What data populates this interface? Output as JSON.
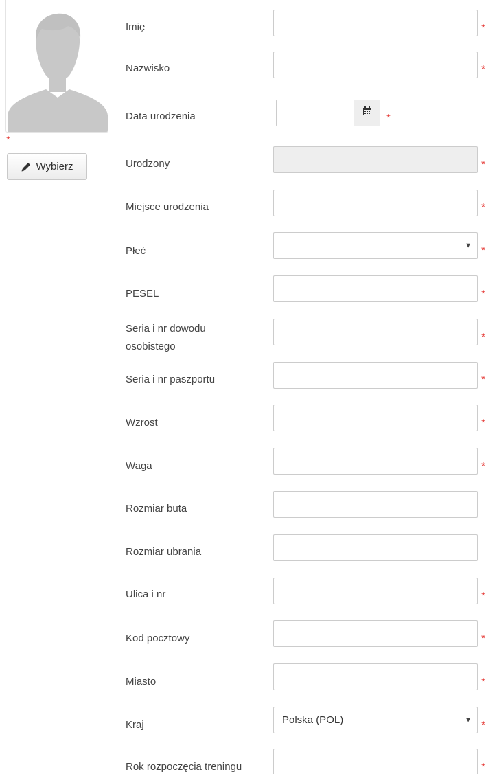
{
  "photo": {
    "required_mark": "*",
    "choose_label": "Wybierz",
    "avatar_icon": "avatar-placeholder-icon",
    "pencil_icon": "pencil-icon"
  },
  "required_mark": "*",
  "fields": {
    "first_name": {
      "label": "Imię",
      "value": ""
    },
    "last_name": {
      "label": "Nazwisko",
      "value": ""
    },
    "birth_date": {
      "label": "Data urodzenia",
      "value": "",
      "icon": "calendar-icon"
    },
    "born": {
      "label": "Urodzony",
      "value": ""
    },
    "birth_place": {
      "label": "Miejsce urodzenia",
      "value": ""
    },
    "gender": {
      "label": "Płeć",
      "selected": ""
    },
    "pesel": {
      "label": "PESEL",
      "value": ""
    },
    "id_card": {
      "label": "Seria i nr dowodu osobistego",
      "value": ""
    },
    "passport": {
      "label": "Seria i nr paszportu",
      "value": ""
    },
    "height": {
      "label": "Wzrost",
      "value": ""
    },
    "weight": {
      "label": "Waga",
      "value": ""
    },
    "shoe_size": {
      "label": "Rozmiar buta",
      "value": ""
    },
    "clothing_size": {
      "label": "Rozmiar ubrania",
      "value": ""
    },
    "street": {
      "label": "Ulica i nr",
      "value": ""
    },
    "postal_code": {
      "label": "Kod pocztowy",
      "value": ""
    },
    "city": {
      "label": "Miasto",
      "value": ""
    },
    "country": {
      "label": "Kraj",
      "selected": "Polska (POL)"
    },
    "training_start": {
      "label": "Rok rozpoczęcia treningu",
      "value": ""
    }
  },
  "colors": {
    "required": "#e53935",
    "border": "#cccccc",
    "readonly_bg": "#eeeeee"
  }
}
